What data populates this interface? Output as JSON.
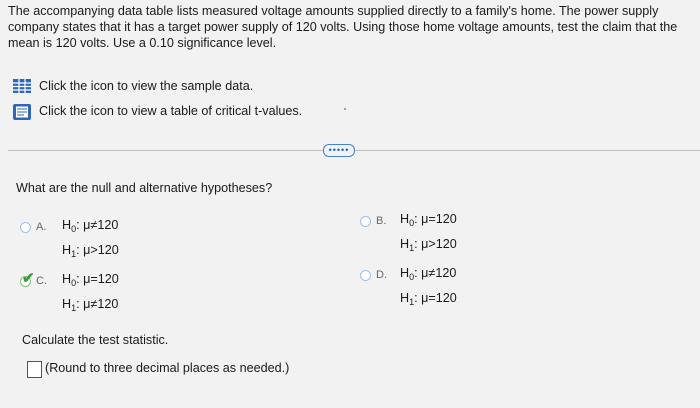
{
  "question_intro": "The accompanying data table lists measured voltage amounts supplied directly to a family's home. The power supply company states that it has a target power supply of 120 volts. Using those home voltage amounts, test the claim that the mean is 120 volts. Use a 0.10 significance level.",
  "links": {
    "sample_data": "Click the icon to view the sample data.",
    "critical_values": "Click the icon to view a table of critical t-values."
  },
  "more_button": "•••••",
  "question": "What are the null and alternative hypotheses?",
  "choices": [
    {
      "letter": "A.",
      "h0_rel": "≠",
      "h0_val": "120",
      "h1_rel": ">",
      "h1_val": "120",
      "selected": false
    },
    {
      "letter": "B.",
      "h0_rel": "=",
      "h0_val": "120",
      "h1_rel": ">",
      "h1_val": "120",
      "selected": false
    },
    {
      "letter": "C.",
      "h0_rel": "=",
      "h0_val": "120",
      "h1_rel": "≠",
      "h1_val": "120",
      "selected": true
    },
    {
      "letter": "D.",
      "h0_rel": "≠",
      "h0_val": "120",
      "h1_rel": "=",
      "h1_val": "120",
      "selected": false
    }
  ],
  "symbols": {
    "H": "H",
    "zero": "0",
    "one": "1",
    "mu": "μ"
  },
  "calculate_prompt": "Calculate the test statistic.",
  "round_note": "(Round to three decimal places as needed.)"
}
